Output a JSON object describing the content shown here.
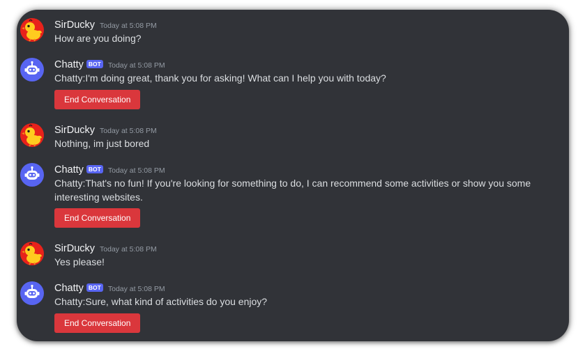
{
  "users": {
    "human": {
      "name": "SirDucky",
      "avatar_icon": "duck-avatar-icon",
      "avatar_bg": "#e8221b"
    },
    "bot": {
      "name": "Chatty",
      "tag": "BOT",
      "avatar_icon": "robot-avatar-icon",
      "avatar_bg": "#5865f2"
    }
  },
  "colors": {
    "background": "#313338",
    "button_red": "#da373c",
    "bot_tag": "#5865f2"
  },
  "messages": [
    {
      "author": "SirDucky",
      "timestamp": "Today at 5:08 PM",
      "text": "How are you doing?"
    },
    {
      "author": "Chatty",
      "bot_tag": "BOT",
      "timestamp": "Today at 5:08 PM",
      "text": "Chatty:I'm doing great, thank you for asking! What can I help you with today?",
      "button": "End Conversation"
    },
    {
      "author": "SirDucky",
      "timestamp": "Today at 5:08 PM",
      "text": "Nothing, im just bored"
    },
    {
      "author": "Chatty",
      "bot_tag": "BOT",
      "timestamp": "Today at 5:08 PM",
      "text": "Chatty:That's no fun! If you're looking for something to do, I can recommend some activities or show you some interesting websites.",
      "button": "End Conversation"
    },
    {
      "author": "SirDucky",
      "timestamp": "Today at 5:08 PM",
      "text": "Yes please!"
    },
    {
      "author": "Chatty",
      "bot_tag": "BOT",
      "timestamp": "Today at 5:08 PM",
      "text": "Chatty:Sure, what kind of activities do you enjoy?",
      "button": "End Conversation"
    }
  ]
}
